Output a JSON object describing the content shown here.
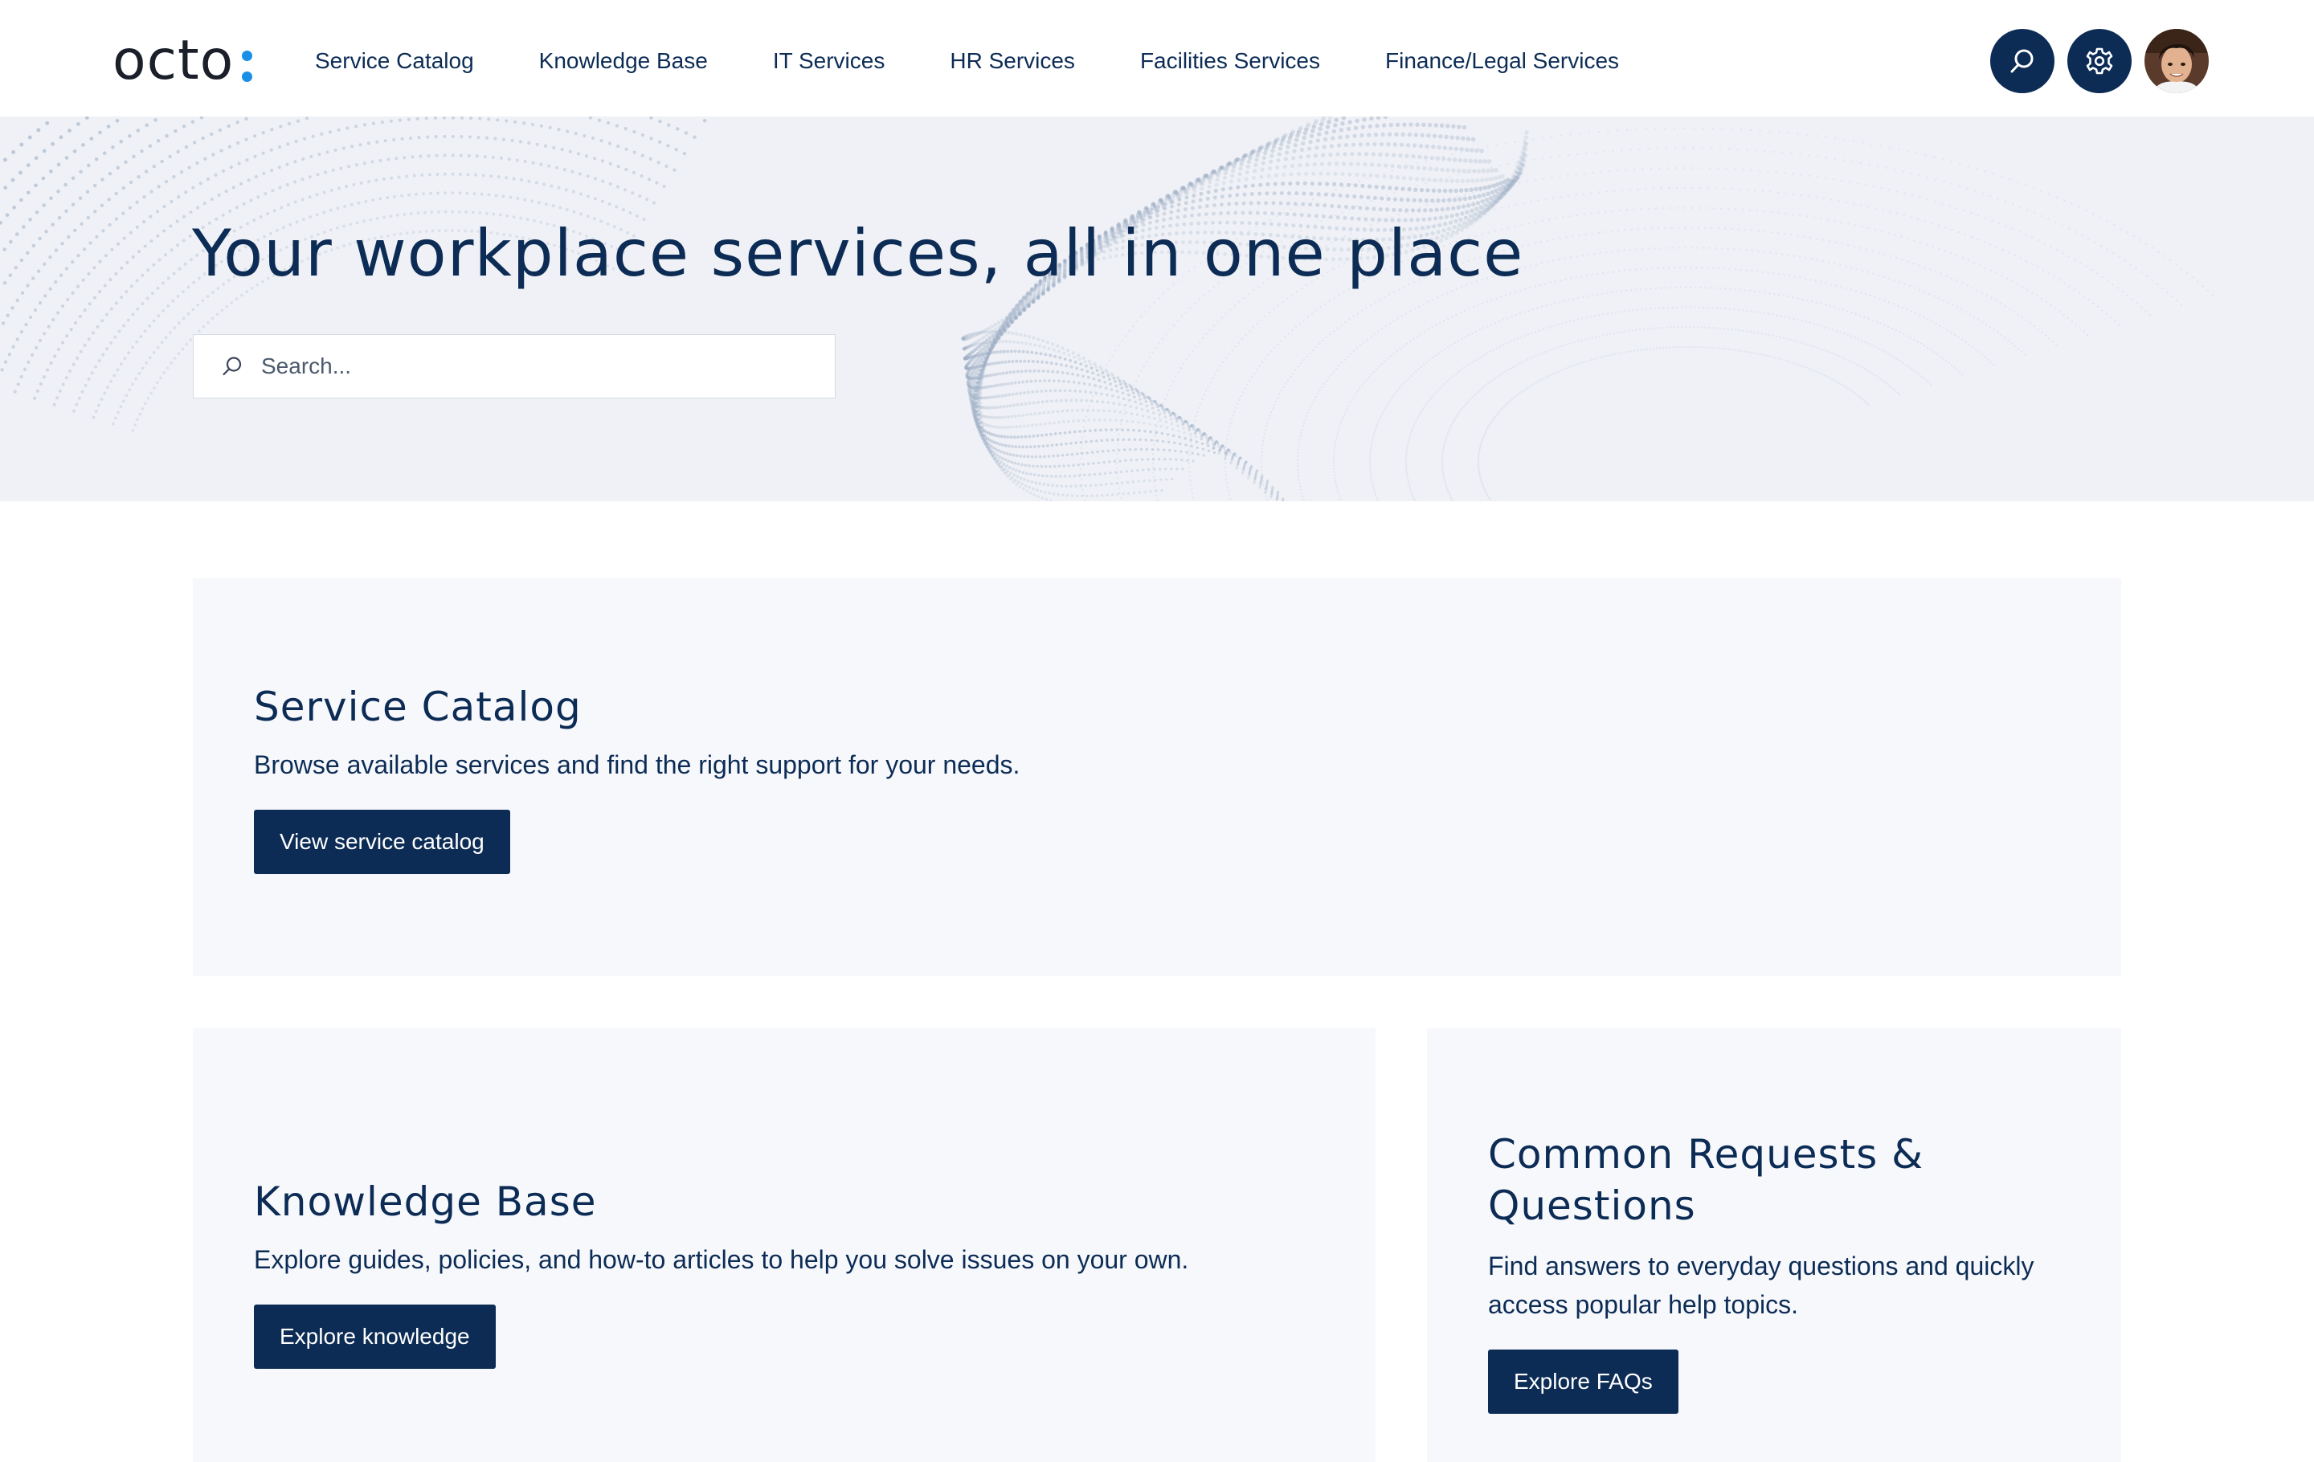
{
  "header": {
    "logo_text": "octo",
    "nav": [
      {
        "label": "Service Catalog"
      },
      {
        "label": "Knowledge Base"
      },
      {
        "label": "IT Services"
      },
      {
        "label": "HR Services"
      },
      {
        "label": "Facilities Services"
      },
      {
        "label": "Finance/Legal Services"
      }
    ],
    "actions": {
      "search_icon": "search-icon",
      "settings_icon": "gear-icon",
      "avatar": "user-avatar"
    }
  },
  "hero": {
    "title": "Your workplace services, all in one place",
    "search": {
      "placeholder": "Search...",
      "value": ""
    }
  },
  "cards": {
    "service_catalog": {
      "title": "Service Catalog",
      "description": "Browse available services and find the right support for your needs.",
      "button": "View service catalog"
    },
    "knowledge_base": {
      "title": "Knowledge Base",
      "description": "Explore guides, policies, and how-to articles to help you solve issues on your own.",
      "button": "Explore knowledge"
    },
    "common_requests": {
      "title": "Common Requests & Questions",
      "description": "Find answers to everyday questions and quickly access popular help topics.",
      "button": "Explore FAQs"
    }
  },
  "colors": {
    "primary": "#0c2c55",
    "accent_logo": "#1a8fe8",
    "hero_bg": "#eff1f6",
    "card_bg": "#f7f8fc"
  }
}
